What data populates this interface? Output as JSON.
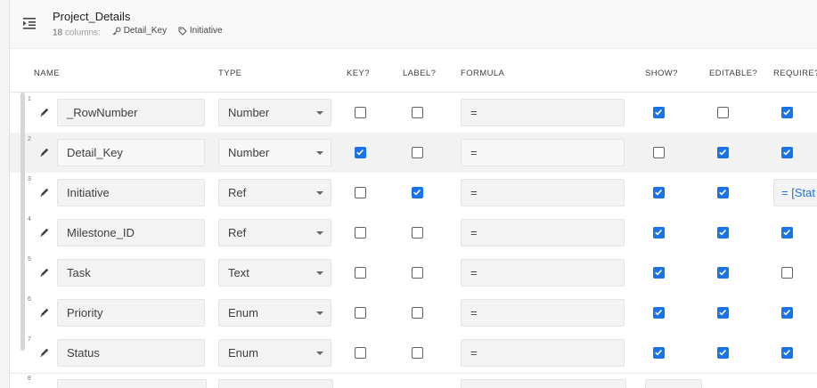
{
  "header": {
    "title": "Project_Details",
    "columns_count": "18",
    "columns_word": "columns:",
    "key_tag": "Detail_Key",
    "label_tag": "Initiative"
  },
  "columns": {
    "name": "NAME",
    "type": "TYPE",
    "key": "KEY?",
    "label": "LABEL?",
    "formula": "FORMULA",
    "show": "SHOW?",
    "editable": "EDITABLE?",
    "require": "REQUIRE?"
  },
  "rows": [
    {
      "num": "1",
      "name": "_RowNumber",
      "type": "Number",
      "key": false,
      "label": false,
      "formula": "=",
      "show": true,
      "editable": false,
      "require": true,
      "require_formula": ""
    },
    {
      "num": "2",
      "name": "Detail_Key",
      "type": "Number",
      "key": true,
      "label": false,
      "formula": "=",
      "show": false,
      "editable": true,
      "require": true,
      "require_formula": ""
    },
    {
      "num": "3",
      "name": "Initiative",
      "type": "Ref",
      "key": false,
      "label": true,
      "formula": "=",
      "show": true,
      "editable": true,
      "require": null,
      "require_formula": "= [Stat"
    },
    {
      "num": "4",
      "name": "Milestone_ID",
      "type": "Ref",
      "key": false,
      "label": false,
      "formula": "=",
      "show": true,
      "editable": true,
      "require": true,
      "require_formula": ""
    },
    {
      "num": "5",
      "name": "Task",
      "type": "Text",
      "key": false,
      "label": false,
      "formula": "=",
      "show": true,
      "editable": true,
      "require": false,
      "require_formula": ""
    },
    {
      "num": "6",
      "name": "Priority",
      "type": "Enum",
      "key": false,
      "label": false,
      "formula": "=",
      "show": true,
      "editable": true,
      "require": true,
      "require_formula": ""
    },
    {
      "num": "7",
      "name": "Status",
      "type": "Enum",
      "key": false,
      "label": false,
      "formula": "=",
      "show": true,
      "editable": true,
      "require": true,
      "require_formula": ""
    }
  ],
  "partial_row": {
    "num": "8"
  },
  "icons": {
    "menu": "collapse-menu-icon",
    "edit": "pencil-icon",
    "key": "key-icon",
    "label": "tag-icon"
  },
  "colors": {
    "accent": "#1a73e8",
    "header_bg": "#f8f8f8",
    "alt_row_bg": "#f2f2f2"
  }
}
